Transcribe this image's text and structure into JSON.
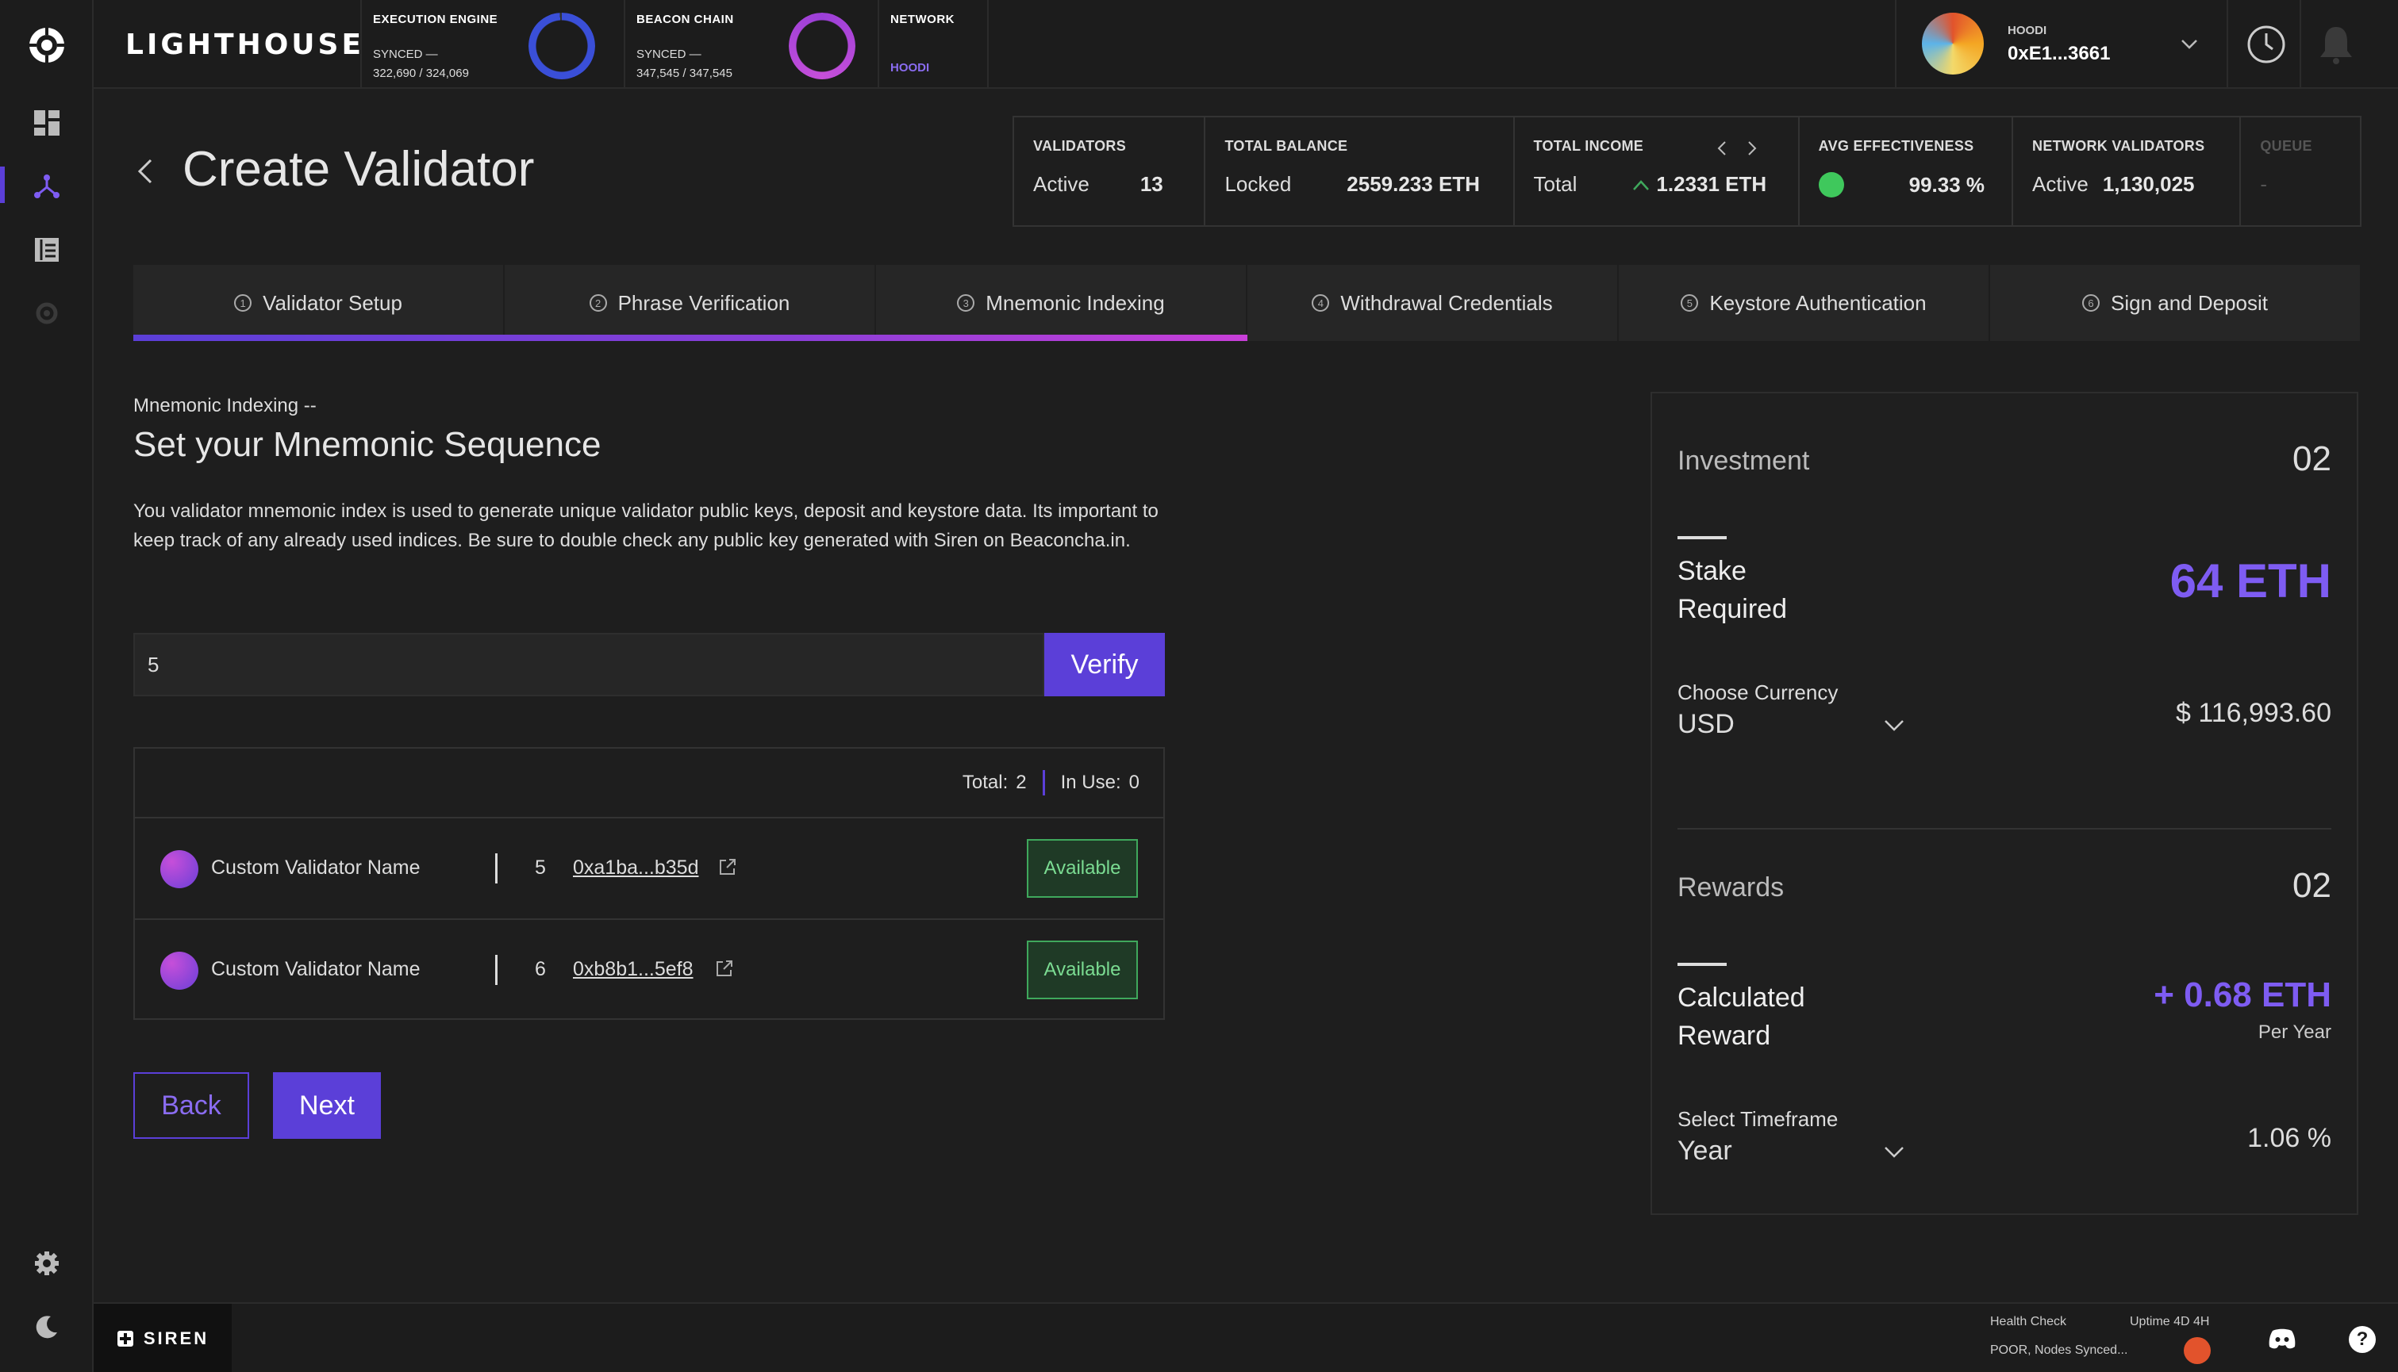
{
  "brand": "LIGHTHOUSE",
  "topbar": {
    "execution": {
      "title": "EXECUTION ENGINE",
      "status": "SYNCED —",
      "progress": "322,690 / 324,069"
    },
    "beacon": {
      "title": "BEACON CHAIN",
      "status": "SYNCED —",
      "progress": "347,545 / 347,545"
    },
    "network": {
      "title": "NETWORK",
      "value": "HOODI"
    },
    "account": {
      "network": "HOODI",
      "address": "0xE1...3661"
    }
  },
  "page": {
    "title": "Create Validator"
  },
  "summary": {
    "validators": {
      "label": "VALIDATORS",
      "key": "Active",
      "value": "13"
    },
    "balance": {
      "label": "TOTAL BALANCE",
      "key": "Locked",
      "value": "2559.233 ETH"
    },
    "income": {
      "label": "TOTAL INCOME",
      "key": "Total",
      "value": "1.2331 ETH"
    },
    "effectiveness": {
      "label": "AVG EFFECTIVENESS",
      "value": "99.33 %"
    },
    "network_validators": {
      "label": "NETWORK VALIDATORS",
      "key": "Active",
      "value": "1,130,025"
    },
    "queue": {
      "label": "QUEUE",
      "value": "-"
    }
  },
  "steps": [
    {
      "num": "1",
      "label": "Validator Setup"
    },
    {
      "num": "2",
      "label": "Phrase Verification"
    },
    {
      "num": "3",
      "label": "Mnemonic Indexing"
    },
    {
      "num": "4",
      "label": "Withdrawal Credentials"
    },
    {
      "num": "5",
      "label": "Keystore Authentication"
    },
    {
      "num": "6",
      "label": "Sign and Deposit"
    }
  ],
  "section": {
    "subtitle": "Mnemonic Indexing --",
    "title": "Set your Mnemonic Sequence",
    "description": "You validator mnemonic index is used to generate unique validator public keys, deposit and keystore data. Its important to keep track of any already used indices. Be sure to double check any public key generated with Siren on Beaconcha.in.",
    "index_value": "5",
    "verify_label": "Verify"
  },
  "table": {
    "total_label": "Total:",
    "total_value": "2",
    "inuse_label": "In Use:",
    "inuse_value": "0",
    "rows": [
      {
        "name": "Custom Validator Name",
        "index": "5",
        "key": "0xa1ba...b35d",
        "status": "Available"
      },
      {
        "name": "Custom Validator Name",
        "index": "6",
        "key": "0xb8b1...5ef8",
        "status": "Available"
      }
    ]
  },
  "buttons": {
    "back": "Back",
    "next": "Next"
  },
  "panel": {
    "investment": {
      "title": "Investment",
      "num": "02",
      "stake_label_1": "Stake",
      "stake_label_2": "Required",
      "stake_value": "64 ETH",
      "currency_label": "Choose Currency",
      "currency": "USD",
      "amount": "$ 116,993.60"
    },
    "rewards": {
      "title": "Rewards",
      "num": "02",
      "calc_label_1": "Calculated",
      "calc_label_2": "Reward",
      "value": "+ 0.68 ETH",
      "per": "Per Year",
      "timeframe_label": "Select Timeframe",
      "timeframe": "Year",
      "rate": "1.06 %"
    }
  },
  "footer": {
    "siren": "SIREN",
    "health_title": "Health Check",
    "health_status": "POOR, Nodes Synced...",
    "uptime": "Uptime 4D 4H",
    "health_color": "#e2532c"
  },
  "colors": {
    "accent": "#5b3fd8",
    "accent_text": "#7e5cf2",
    "available": "#3fa85c"
  }
}
